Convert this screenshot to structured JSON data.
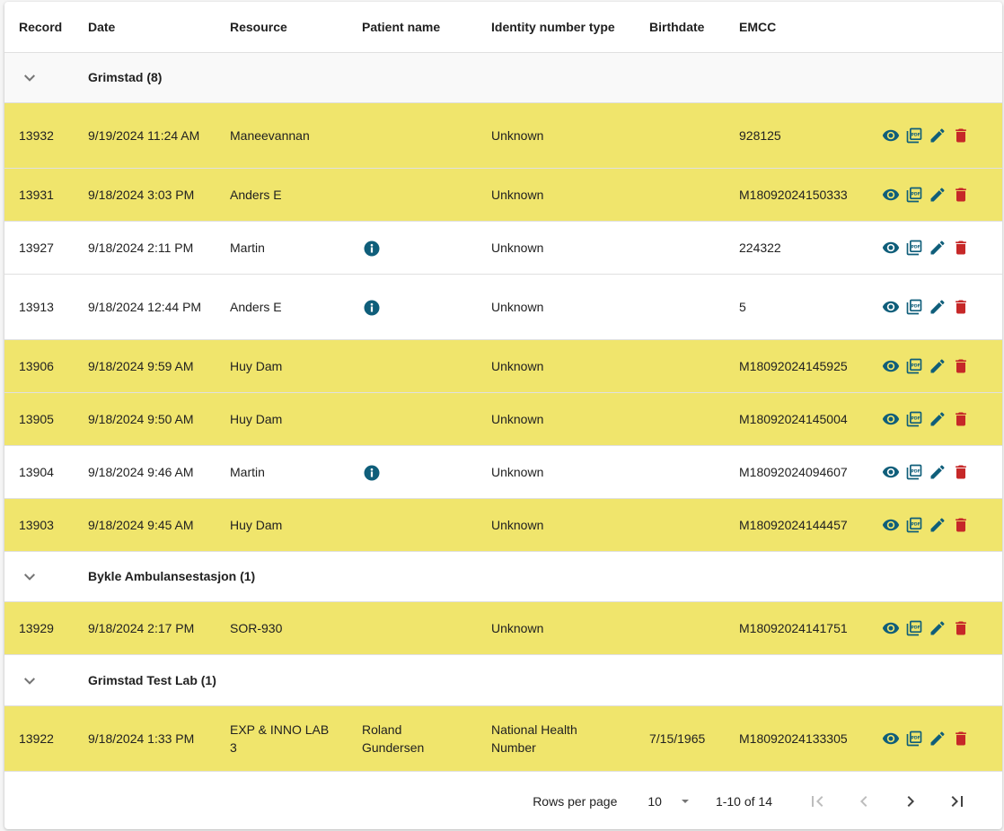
{
  "columns": [
    "Record",
    "Date",
    "Resource",
    "Patient name",
    "Identity number type",
    "Birthdate",
    "EMCC"
  ],
  "colors": {
    "highlight_row": "#f0e56c",
    "action_icon": "#0f5e7a",
    "delete_icon": "#c62828",
    "info_icon": "#0f5e7a"
  },
  "groups": [
    {
      "label": "Grimstad (8)",
      "expanded": true,
      "rows": [
        {
          "record": "13932",
          "date": "9/19/2024 11:24 AM",
          "resource": "Maneevannan",
          "patient": "",
          "info": false,
          "id_type": "Unknown",
          "birthdate": "",
          "emcc": "928125",
          "highlighted": true
        },
        {
          "record": "13931",
          "date": "9/18/2024 3:03 PM",
          "resource": "Anders E",
          "patient": "",
          "info": false,
          "id_type": "Unknown",
          "birthdate": "",
          "emcc": "M18092024150333",
          "highlighted": true
        },
        {
          "record": "13927",
          "date": "9/18/2024 2:11 PM",
          "resource": "Martin",
          "patient": "",
          "info": true,
          "id_type": "Unknown",
          "birthdate": "",
          "emcc": "224322",
          "highlighted": false
        },
        {
          "record": "13913",
          "date": "9/18/2024 12:44 PM",
          "resource": "Anders E",
          "patient": "",
          "info": true,
          "id_type": "Unknown",
          "birthdate": "",
          "emcc": "5",
          "highlighted": false
        },
        {
          "record": "13906",
          "date": "9/18/2024 9:59 AM",
          "resource": "Huy Dam",
          "patient": "",
          "info": false,
          "id_type": "Unknown",
          "birthdate": "",
          "emcc": "M18092024145925",
          "highlighted": true
        },
        {
          "record": "13905",
          "date": "9/18/2024 9:50 AM",
          "resource": "Huy Dam",
          "patient": "",
          "info": false,
          "id_type": "Unknown",
          "birthdate": "",
          "emcc": "M18092024145004",
          "highlighted": true
        },
        {
          "record": "13904",
          "date": "9/18/2024 9:46 AM",
          "resource": "Martin",
          "patient": "",
          "info": true,
          "id_type": "Unknown",
          "birthdate": "",
          "emcc": "M18092024094607",
          "highlighted": false
        },
        {
          "record": "13903",
          "date": "9/18/2024 9:45 AM",
          "resource": "Huy Dam",
          "patient": "",
          "info": false,
          "id_type": "Unknown",
          "birthdate": "",
          "emcc": "M18092024144457",
          "highlighted": true
        }
      ]
    },
    {
      "label": "Bykle Ambulansestasjon (1)",
      "expanded": true,
      "rows": [
        {
          "record": "13929",
          "date": "9/18/2024 2:17 PM",
          "resource": "SOR-930",
          "patient": "",
          "info": false,
          "id_type": "Unknown",
          "birthdate": "",
          "emcc": "M18092024141751",
          "highlighted": true
        }
      ]
    },
    {
      "label": "Grimstad Test Lab (1)",
      "expanded": true,
      "rows": [
        {
          "record": "13922",
          "date": "9/18/2024 1:33 PM",
          "resource": "EXP & INNO LAB 3",
          "patient": "Roland Gundersen",
          "info": false,
          "id_type": "National Health Number",
          "birthdate": "7/15/1965",
          "emcc": "M18092024133305",
          "highlighted": true
        }
      ]
    }
  ],
  "row_actions": [
    "view-icon",
    "pdf-icon",
    "edit-icon",
    "delete-icon"
  ],
  "pagination": {
    "rows_per_page_label": "Rows per page",
    "rows_per_page": "10",
    "range": "1-10 of 14",
    "first_enabled": false,
    "prev_enabled": false,
    "next_enabled": true,
    "last_enabled": true
  }
}
